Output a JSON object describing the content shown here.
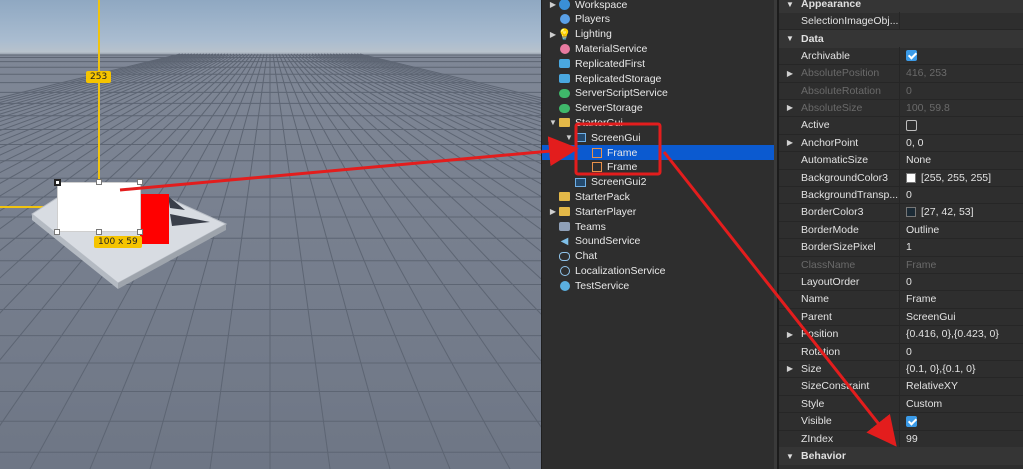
{
  "viewport": {
    "height_label": "253",
    "size_label": "100 x 59"
  },
  "explorer": {
    "items": [
      {
        "label": "Workspace",
        "icon": "workspace-icon",
        "expand": "▶",
        "indent": 0
      },
      {
        "label": "Players",
        "icon": "players-icon",
        "expand": "",
        "indent": 0
      },
      {
        "label": "Lighting",
        "icon": "lighting-icon",
        "expand": "▶",
        "indent": 0
      },
      {
        "label": "MaterialService",
        "icon": "material-service-icon",
        "expand": "",
        "indent": 0
      },
      {
        "label": "ReplicatedFirst",
        "icon": "replicated-first-icon",
        "expand": "",
        "indent": 0
      },
      {
        "label": "ReplicatedStorage",
        "icon": "replicated-storage-icon",
        "expand": "",
        "indent": 0
      },
      {
        "label": "ServerScriptService",
        "icon": "server-script-service-icon",
        "expand": "",
        "indent": 0
      },
      {
        "label": "ServerStorage",
        "icon": "server-storage-icon",
        "expand": "",
        "indent": 0
      },
      {
        "label": "StarterGui",
        "icon": "folder-icon",
        "expand": "▼",
        "indent": 0
      },
      {
        "label": "ScreenGui",
        "icon": "screengui-icon",
        "expand": "▼",
        "indent": 1
      },
      {
        "label": "Frame",
        "icon": "frame-icon",
        "expand": "",
        "indent": 2,
        "selected": true
      },
      {
        "label": "Frame",
        "icon": "frame-icon",
        "expand": "",
        "indent": 2
      },
      {
        "label": "ScreenGui2",
        "icon": "screengui-icon",
        "expand": "",
        "indent": 1
      },
      {
        "label": "StarterPack",
        "icon": "folder-icon",
        "expand": "",
        "indent": 0
      },
      {
        "label": "StarterPlayer",
        "icon": "folder-icon",
        "expand": "▶",
        "indent": 0
      },
      {
        "label": "Teams",
        "icon": "teams-icon",
        "expand": "",
        "indent": 0
      },
      {
        "label": "SoundService",
        "icon": "sound-service-icon",
        "expand": "",
        "indent": 0
      },
      {
        "label": "Chat",
        "icon": "chat-icon",
        "expand": "",
        "indent": 0
      },
      {
        "label": "LocalizationService",
        "icon": "localization-icon",
        "expand": "",
        "indent": 0
      },
      {
        "label": "TestService",
        "icon": "test-service-icon",
        "expand": "",
        "indent": 0
      }
    ]
  },
  "properties": {
    "rows": [
      {
        "kind": "section",
        "label": "Appearance",
        "expand": "▼"
      },
      {
        "kind": "prop",
        "name": "SelectionImageObj...",
        "value": "",
        "expand": ""
      },
      {
        "kind": "section",
        "label": "Data",
        "expand": "▼"
      },
      {
        "kind": "prop",
        "name": "Archivable",
        "value": "",
        "check": "on",
        "expand": ""
      },
      {
        "kind": "prop",
        "name": "AbsolutePosition",
        "value": "416, 253",
        "dim": true,
        "expand": "▶"
      },
      {
        "kind": "prop",
        "name": "AbsoluteRotation",
        "value": "0",
        "dim": true,
        "expand": ""
      },
      {
        "kind": "prop",
        "name": "AbsoluteSize",
        "value": "100, 59.8",
        "dim": true,
        "expand": "▶"
      },
      {
        "kind": "prop",
        "name": "Active",
        "value": "",
        "check": "off",
        "expand": ""
      },
      {
        "kind": "prop",
        "name": "AnchorPoint",
        "value": "0, 0",
        "expand": "▶"
      },
      {
        "kind": "prop",
        "name": "AutomaticSize",
        "value": "None",
        "expand": ""
      },
      {
        "kind": "prop",
        "name": "BackgroundColor3",
        "value": "[255, 255, 255]",
        "swatch": "#ffffff",
        "expand": ""
      },
      {
        "kind": "prop",
        "name": "BackgroundTransp...",
        "value": "0",
        "expand": ""
      },
      {
        "kind": "prop",
        "name": "BorderColor3",
        "value": "[27, 42, 53]",
        "swatch": "#1b2a35",
        "expand": ""
      },
      {
        "kind": "prop",
        "name": "BorderMode",
        "value": "Outline",
        "expand": ""
      },
      {
        "kind": "prop",
        "name": "BorderSizePixel",
        "value": "1",
        "expand": ""
      },
      {
        "kind": "prop",
        "name": "ClassName",
        "value": "Frame",
        "dim": true,
        "expand": ""
      },
      {
        "kind": "prop",
        "name": "LayoutOrder",
        "value": "0",
        "expand": ""
      },
      {
        "kind": "prop",
        "name": "Name",
        "value": "Frame",
        "expand": ""
      },
      {
        "kind": "prop",
        "name": "Parent",
        "value": "ScreenGui",
        "expand": ""
      },
      {
        "kind": "prop",
        "name": "Position",
        "value": "{0.416, 0},{0.423, 0}",
        "expand": "▶"
      },
      {
        "kind": "prop",
        "name": "Rotation",
        "value": "0",
        "expand": ""
      },
      {
        "kind": "prop",
        "name": "Size",
        "value": "{0.1, 0},{0.1, 0}",
        "expand": "▶"
      },
      {
        "kind": "prop",
        "name": "SizeConstraint",
        "value": "RelativeXY",
        "expand": ""
      },
      {
        "kind": "prop",
        "name": "Style",
        "value": "Custom",
        "expand": ""
      },
      {
        "kind": "prop",
        "name": "Visible",
        "value": "",
        "check": "on",
        "expand": ""
      },
      {
        "kind": "prop",
        "name": "ZIndex",
        "value": "99",
        "expand": ""
      },
      {
        "kind": "section",
        "label": "Behavior",
        "expand": "▼"
      }
    ]
  },
  "colors": {
    "selection": "#0b5ad0",
    "annotation": "#e31d1d",
    "handle": "#f5c400",
    "frame_red": "#ff0000"
  }
}
